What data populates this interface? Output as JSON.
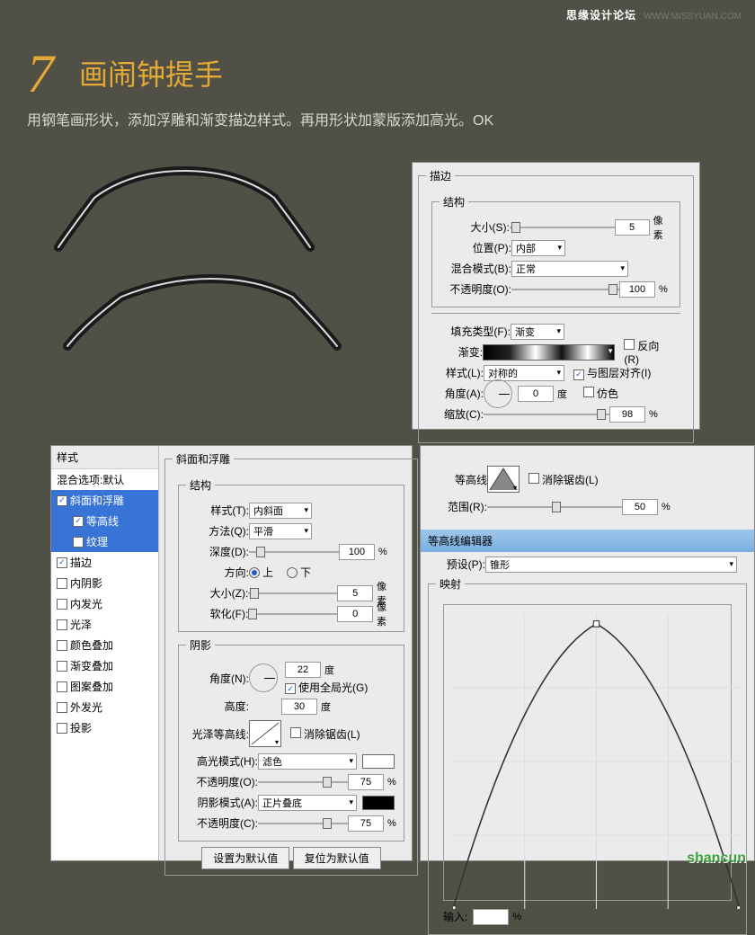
{
  "watermark": {
    "brand": "思缘设计论坛",
    "url": "WWW.MISSYUAN.COM"
  },
  "step": {
    "number": "7",
    "title": "画闹钟提手",
    "desc": "用钢笔画形状，添加浮雕和渐变描边样式。再用形状加蒙版添加高光。OK"
  },
  "stroke": {
    "legend": "描边",
    "structure_legend": "结构",
    "size_label": "大小(S):",
    "size_value": "5",
    "px": "像素",
    "position_label": "位置(P):",
    "position_value": "内部",
    "blend_label": "混合模式(B):",
    "blend_value": "正常",
    "opacity_label": "不透明度(O):",
    "opacity_value": "100",
    "pct": "%",
    "filltype_label": "填充类型(F):",
    "filltype_value": "渐变",
    "gradient_label": "渐变:",
    "reverse_label": "反向(R)",
    "style_label": "样式(L):",
    "style_value": "对称的",
    "align_label": "与图层对齐(I)",
    "angle_label": "角度(A):",
    "angle_value": "0",
    "deg": "度",
    "dither_label": "仿色",
    "scale_label": "缩放(C):",
    "scale_value": "98"
  },
  "bevel": {
    "styles_hdr": "样式",
    "blend_options": "混合选项:默认",
    "items": {
      "bevel": "斜面和浮雕",
      "contour": "等高线",
      "texture": "纹理",
      "stroke": "描边",
      "inner_shadow": "内阴影",
      "inner_glow": "内发光",
      "satin": "光泽",
      "color_overlay": "颜色叠加",
      "gradient_overlay": "渐变叠加",
      "pattern_overlay": "图案叠加",
      "outer_glow": "外发光",
      "drop_shadow": "投影"
    },
    "legend": "斜面和浮雕",
    "structure_legend": "结构",
    "style_label": "样式(T):",
    "style_value": "内斜面",
    "technique_label": "方法(Q):",
    "technique_value": "平滑",
    "depth_label": "深度(D):",
    "depth_value": "100",
    "direction_label": "方向:",
    "up": "上",
    "down": "下",
    "size_label": "大小(Z):",
    "size_value": "5",
    "soften_label": "软化(F):",
    "soften_value": "0",
    "shading_legend": "阴影",
    "angle_label": "角度(N):",
    "angle_value": "22",
    "global_light": "使用全局光(G)",
    "altitude_label": "高度:",
    "altitude_value": "30",
    "gloss_contour_label": "光泽等高线:",
    "antialias_label": "消除锯齿(L)",
    "highlight_mode_label": "高光模式(H):",
    "highlight_mode_value": "滤色",
    "highlight_opacity_label": "不透明度(O):",
    "highlight_opacity_value": "75",
    "shadow_mode_label": "阴影模式(A):",
    "shadow_mode_value": "正片叠底",
    "shadow_opacity_label": "不透明度(C):",
    "shadow_opacity_value": "75",
    "btn_default": "设置为默认值",
    "btn_reset": "复位为默认值",
    "px": "像素",
    "pct": "%",
    "deg": "度"
  },
  "contour": {
    "legend": "等高线",
    "antialias_label": "消除锯齿(L)",
    "range_label": "范围(R):",
    "range_value": "50",
    "pct": "%",
    "editor_title": "等高线编辑器",
    "preset_label": "预设(P):",
    "preset_value": "锥形",
    "mapping_legend": "映射",
    "input_label": "输入:",
    "input_value": "",
    "input_pct": "%"
  },
  "bottom_logo": "shancun"
}
